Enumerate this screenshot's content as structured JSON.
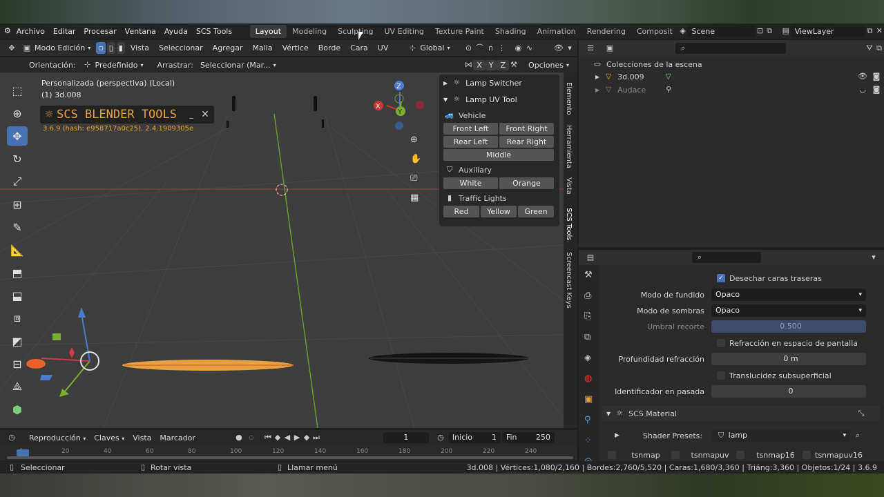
{
  "topmenu": [
    "Archivo",
    "Editar",
    "Procesar",
    "Ventana",
    "Ayuda",
    "SCS Tools"
  ],
  "workspaces": [
    "Layout",
    "Modeling",
    "Sculpting",
    "UV Editing",
    "Texture Paint",
    "Shading",
    "Animation",
    "Rendering",
    "Composit"
  ],
  "active_workspace": "Layout",
  "scene": "Scene",
  "viewlayer": "ViewLayer",
  "header3d": {
    "mode": "Modo Edición",
    "menus": [
      "Vista",
      "Seleccionar",
      "Agregar",
      "Malla",
      "Vértice",
      "Borde",
      "Cara",
      "UV"
    ],
    "transform_orientation": "Global"
  },
  "tooloptions": {
    "orientation_label": "Orientación:",
    "orientation_value": "Predefinido",
    "drag_label": "Arrastrar:",
    "drag_value": "Seleccionar (Mar...",
    "axes": [
      "X",
      "Y",
      "Z"
    ],
    "options": "Opciones"
  },
  "viewport": {
    "view_name": "Personalizada (perspectiva) (Local)",
    "object_name": "(1) 3d.008",
    "addon_title": "SCS BLENDER TOOLS",
    "addon_version": "3.6.9 (hash: e958717a0c25), 2.4.1909305e"
  },
  "npanel": {
    "lamp_switcher": "Lamp Switcher",
    "lamp_uv_tool": "Lamp UV Tool",
    "vehicle_label": "Vehicle",
    "vehicle_buttons": [
      [
        "Front Left",
        "Front Right"
      ],
      [
        "Rear Left",
        "Rear Right"
      ],
      [
        "Middle"
      ]
    ],
    "auxiliary_label": "Auxiliary",
    "auxiliary_buttons": [
      "White",
      "Orange"
    ],
    "traffic_label": "Traffic Lights",
    "traffic_buttons": [
      "Red",
      "Yellow",
      "Green"
    ]
  },
  "vtabs": [
    "Elemento",
    "Herramienta",
    "Vista",
    "SCS Tools",
    "Screencast Keys"
  ],
  "outliner": {
    "root": "Colecciones de la escena",
    "items": [
      "3d.009",
      "Audace"
    ]
  },
  "properties": {
    "backface_culling": "Desechar caras traseras",
    "blend_mode_label": "Modo de fundido",
    "blend_mode_value": "Opaco",
    "shadow_mode_label": "Modo de sombras",
    "shadow_mode_value": "Opaco",
    "clip_label": "Umbral recorte",
    "clip_value": "0.500",
    "screen_refraction": "Refracción en espacio de pantalla",
    "refraction_depth_label": "Profundidad refracción",
    "refraction_depth_value": "0 m",
    "subsurface": "Translucidez subsuperficial",
    "pass_index_label": "Identificador en pasada",
    "pass_index_value": "0",
    "scs_material": "SCS Material",
    "shader_presets_label": "Shader Presets:",
    "shader_presets_value": "lamp",
    "texture_flags": [
      "tsnmap",
      "tsnmapuv",
      "tsnmap16",
      "tsnmapuv16"
    ]
  },
  "timeline": {
    "menus": [
      "Reproducción",
      "Claves",
      "Vista",
      "Marcador"
    ],
    "current_frame": "1",
    "start_label": "Inicio",
    "start_value": "1",
    "end_label": "Fin",
    "end_value": "250",
    "ruler_ticks": [
      "1",
      "20",
      "40",
      "60",
      "80",
      "100",
      "120",
      "140",
      "160",
      "180",
      "200",
      "220",
      "240"
    ]
  },
  "status": {
    "select": "Seleccionar",
    "rotate": "Rotar vista",
    "menu": "Llamar menú",
    "stats": "3d.008 | Vértices:1,080/2,160 | Bordes:2,760/5,520 | Caras:1,680/3,360 | Triáng:3,360 | Objetos:1/24 | 3.6.9"
  },
  "colors": {
    "accent": "#4772b3",
    "addon": "#e8a33a",
    "orange_mesh": "#e8a040"
  }
}
